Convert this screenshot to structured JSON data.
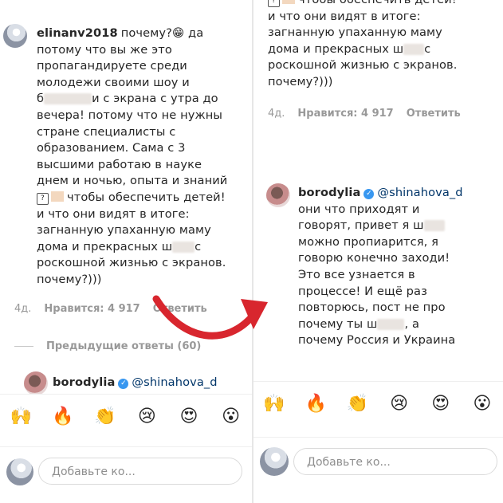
{
  "left": {
    "comment": {
      "username": "elinanv2018",
      "line1_rest": "почему?",
      "emoji1": "😁",
      "line1_end": "да",
      "lines_a": "потому что вы же это\nпропагандируете среди\nмолодежи своими шоу и",
      "line_b_pre": "б",
      "line_b_post": "и с экрана с утра до",
      "lines_c": "вечера! потому что не нужны\nстране специалисты с\nобразованием. Сама с 3\nвысшими работаю в науке\nднем и ночью, опыта и знаний",
      "line_d_post": "чтобы обеспечить детей!",
      "lines_e": "и что они видят в итоге:\nзагнанную упаханную маму",
      "line_f_pre": "дома и прекрасных ш",
      "line_f_post": "с",
      "lines_g": "роскошной жизнью с экранов.\nпочему?)))"
    },
    "meta": {
      "time": "4д.",
      "likes": "Нравится: 4 917",
      "reply": "Ответить"
    },
    "previous_replies": "Предыдущие ответы (60)",
    "reply": {
      "username": "borodylia",
      "mention": "@shinahova_d"
    },
    "input_placeholder": "Добавьте ко..."
  },
  "right": {
    "top_comment": {
      "line_top": "чтобы обеспечить детей!",
      "lines_a": "и что они видят в итоге:\nзагнанную упаханную маму",
      "line_b_pre": "дома и прекрасных ш",
      "line_b_post": "с",
      "lines_c": "роскошной жизнью с экранов.\nпочему?)))"
    },
    "meta": {
      "time": "4д.",
      "likes": "Нравится: 4 917",
      "reply": "Ответить"
    },
    "reply": {
      "username": "borodylia",
      "mention": "@shinahova_d",
      "line1_pre": "они что приходят и\nговорят, привет я ш",
      "lines_a": "можно пропиарится, я\nговорю конечно заходи!\nЭто все узнается в\nпроцессе! И ещё раз\nповторюсь, пост не про",
      "line_b_pre": "почему ты ш",
      "line_b_post": ", а",
      "lines_c": "почему Россия и Украина"
    },
    "input_placeholder": "Добавьте ко..."
  },
  "emojis": [
    "🙌",
    "🔥",
    "👏",
    "😢",
    "😍",
    "😮"
  ],
  "colors": {
    "arrow": "#d8262e",
    "verified": "#3897f0",
    "meta_gray": "#999999",
    "mention": "#003569"
  }
}
